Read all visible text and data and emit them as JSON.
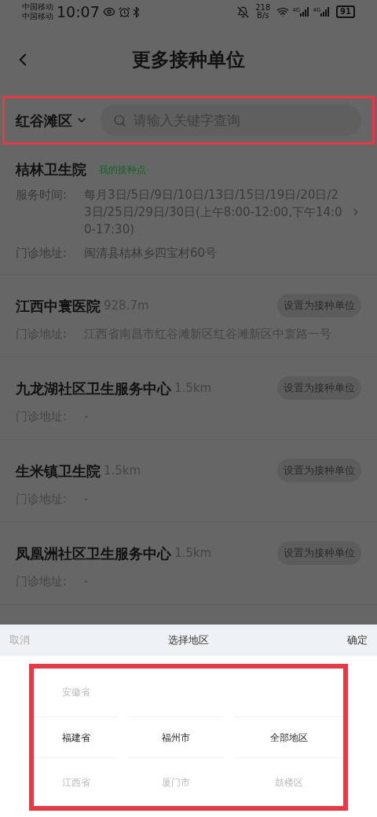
{
  "status_bar": {
    "carriers": [
      "中国移动",
      "中国移动"
    ],
    "time": "10:07",
    "speed": [
      "218",
      "B/s"
    ],
    "network": [
      "4G",
      "4G"
    ],
    "battery": "91"
  },
  "header": {
    "title": "更多接种单位"
  },
  "filter": {
    "region": "红谷滩区",
    "search_placeholder": "请输入关键字查询"
  },
  "my_site": {
    "name": "桔林卫生院",
    "badge": "我的接种点",
    "hours_label": "服务时间:",
    "hours": "每月3日/5日/9日/10日/13日/15日/19日/20日/23日/25日/29日/30日(上午8:00-12:00,下午14:00-17:30)",
    "address_label": "门诊地址:",
    "address": "闽清县桔林乡四宝村60号"
  },
  "sites": [
    {
      "name": "江西中寰医院",
      "distance": "928.7m",
      "button": "设置为接种单位",
      "address_label": "门诊地址:",
      "address": "江西省南昌市红谷滩新区红谷滩新区中寰路一号"
    },
    {
      "name": "九龙湖社区卫生服务中心",
      "distance": "1.5km",
      "button": "设置为接种单位",
      "address_label": "门诊地址:",
      "address": "-"
    },
    {
      "name": "生米镇卫生院",
      "distance": "1.5km",
      "button": "设置为接种单位",
      "address_label": "门诊地址:",
      "address": "-"
    },
    {
      "name": "凤凰洲社区卫生服务中心",
      "distance": "1.5km",
      "button": "设置为接种单位",
      "address_label": "门诊地址:",
      "address": "-"
    }
  ],
  "picker": {
    "cancel": "取消",
    "title": "选择地区",
    "confirm": "确定",
    "columns": [
      {
        "options": [
          {
            "label": "安徽省",
            "selected": false
          },
          {
            "label": "福建省",
            "selected": true
          },
          {
            "label": "江西省",
            "selected": false
          }
        ]
      },
      {
        "options": [
          {
            "label": "福州市",
            "selected": true
          },
          {
            "label": "厦门市",
            "selected": false
          }
        ]
      },
      {
        "options": [
          {
            "label": "全部地区",
            "selected": true
          },
          {
            "label": "鼓楼区",
            "selected": false
          }
        ]
      }
    ]
  }
}
